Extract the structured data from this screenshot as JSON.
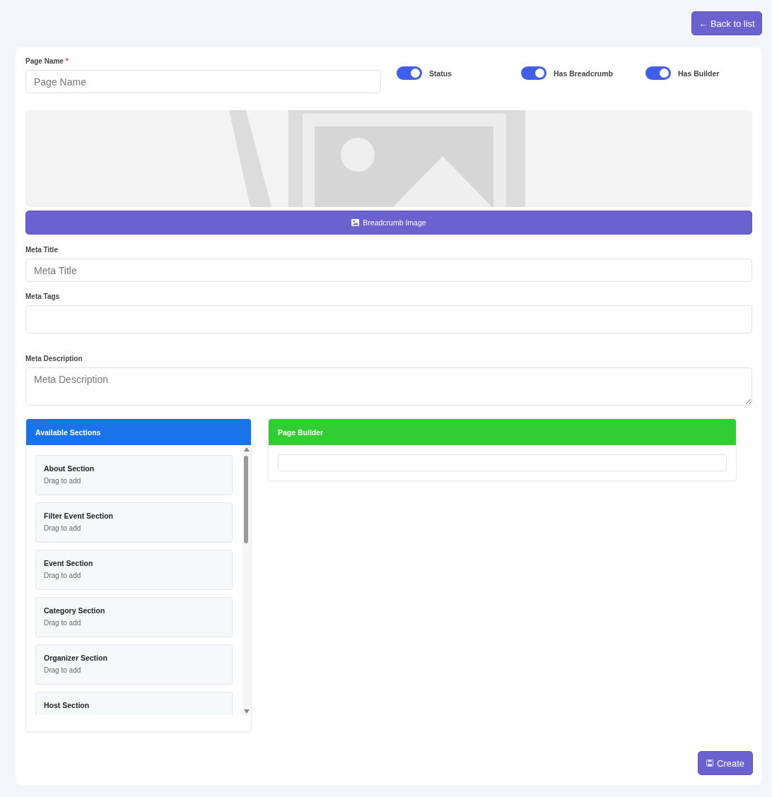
{
  "back_button": {
    "label": "← Back to list"
  },
  "page_name": {
    "label": "Page Name",
    "required_mark": "*",
    "placeholder": "Page Name"
  },
  "toggles": [
    {
      "label": "Status",
      "on": true
    },
    {
      "label": "Has Breadcrumb",
      "on": true
    },
    {
      "label": "Has Builder",
      "on": true
    }
  ],
  "breadcrumb_image": {
    "kind": "picture",
    "button_label": "Breadcrumb Image"
  },
  "meta_title": {
    "label": "Meta Title",
    "placeholder": "Meta Title"
  },
  "meta_tags": {
    "label": "Meta Tags"
  },
  "meta_description": {
    "label": "Meta Description",
    "placeholder": "Meta Description"
  },
  "available_sections": {
    "title": "Available Sections",
    "items": [
      {
        "title": "About Section",
        "subtitle": "Drag to add"
      },
      {
        "title": "Filter Event Section",
        "subtitle": "Drag to add"
      },
      {
        "title": "Event Section",
        "subtitle": "Drag to add"
      },
      {
        "title": "Category Section",
        "subtitle": "Drag to add"
      },
      {
        "title": "Organizer Section",
        "subtitle": "Drag to add"
      },
      {
        "title": "Host Section"
      }
    ]
  },
  "page_builder": {
    "title": "Page Builder"
  },
  "create_button": {
    "label": "Create"
  }
}
